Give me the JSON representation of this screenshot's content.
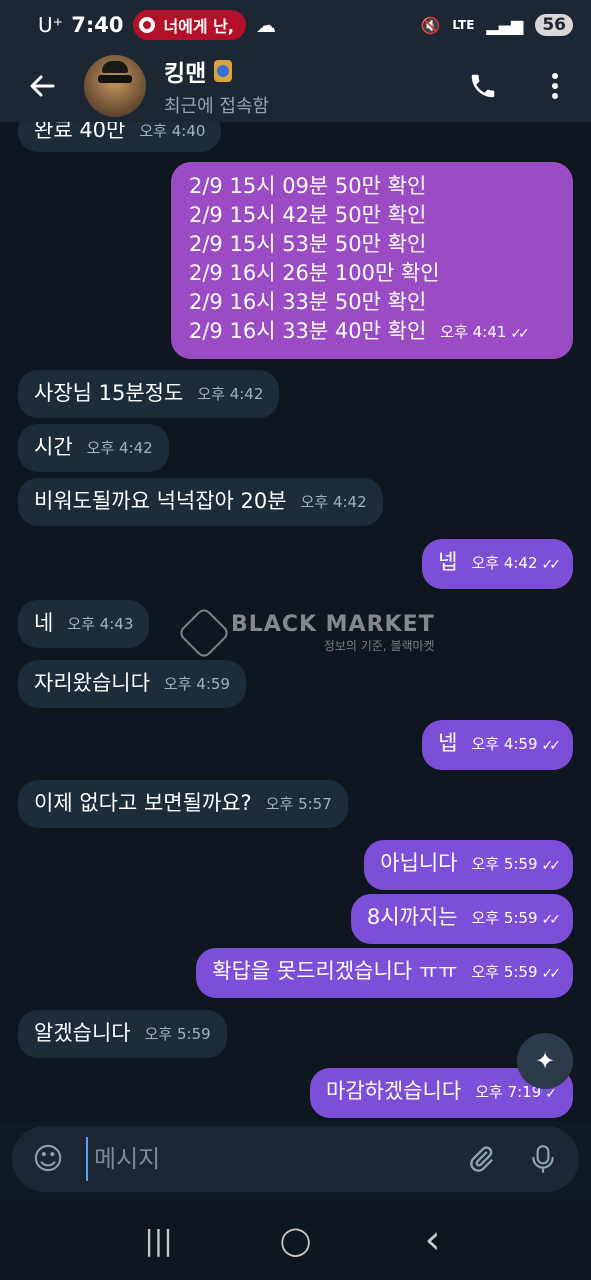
{
  "status_bar": {
    "carrier": "U⁺",
    "time": "7:40",
    "notification": "너에게 난,",
    "network": "LTE",
    "battery": "56"
  },
  "header": {
    "back_icon": "arrow-left-icon",
    "name": "킹맨",
    "status": "최근에 접속함",
    "call_icon": "phone-icon",
    "menu_icon": "more-vert-icon"
  },
  "messages": [
    {
      "dir": "in",
      "text": "완료 40만",
      "time": "오후 4:40"
    },
    {
      "dir": "out",
      "lines": [
        "2/9 15시 09분 50만 확인",
        "2/9 15시 42분 50만 확인",
        "2/9 15시 53분 50만 확인",
        "2/9 16시 26분 100만 확인",
        "2/9 16시 33분 50만 확인",
        "2/9 16시 33분 40만 확인"
      ],
      "time": "오후 4:41",
      "read": true
    },
    {
      "dir": "in",
      "text": "사장님 15분정도",
      "time": "오후 4:42"
    },
    {
      "dir": "in",
      "text": "시간",
      "time": "오후 4:42"
    },
    {
      "dir": "in",
      "text": "비워도될까요 넉넉잡아 20분",
      "time": "오후 4:42"
    },
    {
      "dir": "out",
      "text": "넵",
      "time": "오후 4:42",
      "read": true
    },
    {
      "dir": "in",
      "text": "네",
      "time": "오후 4:43"
    },
    {
      "dir": "in",
      "text": "자리왔습니다",
      "time": "오후 4:59"
    },
    {
      "dir": "out",
      "text": "넵",
      "time": "오후 4:59",
      "read": true
    },
    {
      "dir": "in",
      "text": "이제 없다고 보면될까요?",
      "time": "오후 5:57"
    },
    {
      "dir": "out",
      "text": "아닙니다",
      "time": "오후 5:59",
      "read": true
    },
    {
      "dir": "out",
      "text": "8시까지는",
      "time": "오후 5:59",
      "read": true
    },
    {
      "dir": "out",
      "text": "확답을 못드리겠습니다 ㅠㅠ",
      "time": "오후 5:59",
      "read": true
    },
    {
      "dir": "in",
      "text": "알겠습니다",
      "time": "오후 5:59"
    },
    {
      "dir": "out",
      "text": "마감하겠습니다",
      "time": "오후 7:19",
      "read": false
    }
  ],
  "watermark": {
    "title": "BLACK MARKET",
    "subtitle": "정보의 기준, 블랙마켓"
  },
  "composer": {
    "placeholder": "메시지",
    "emoji_icon": "emoji-icon",
    "attach_icon": "paperclip-icon",
    "mic_icon": "microphone-icon"
  },
  "nav": {
    "recents": "|||",
    "home": "◯",
    "back": "‹"
  },
  "colors": {
    "incoming_bubble": "#1e2b38",
    "outgoing_bubble": "#7d4fd8",
    "background": "#0e1620"
  }
}
